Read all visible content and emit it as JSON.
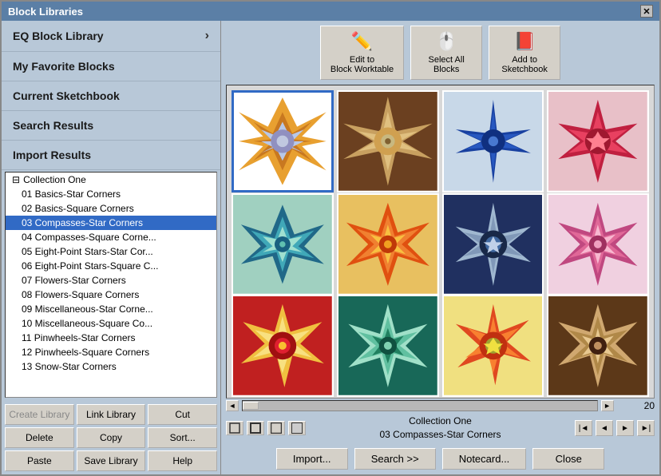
{
  "window": {
    "title": "Block Libraries",
    "close_label": "✕"
  },
  "left_nav": {
    "items": [
      {
        "id": "eq-block-library",
        "label": "EQ Block Library",
        "has_arrow": true
      },
      {
        "id": "my-favorite-blocks",
        "label": "My Favorite Blocks",
        "has_arrow": false
      },
      {
        "id": "current-sketchbook",
        "label": "Current Sketchbook",
        "has_arrow": false
      },
      {
        "id": "search-results",
        "label": "Search Results",
        "has_arrow": false
      },
      {
        "id": "import-results",
        "label": "Import Results",
        "has_arrow": false
      }
    ]
  },
  "tree": {
    "collection_label": "Collection One",
    "items": [
      "01 Basics-Star Corners",
      "02 Basics-Square Corners",
      "03 Compasses-Star Corners",
      "04 Compasses-Square Corne...",
      "05 Eight-Point Stars-Star Cor...",
      "06 Eight-Point Stars-Square C...",
      "07 Flowers-Star Corners",
      "08 Flowers-Square Corners",
      "09 Miscellaneous-Star Corne...",
      "10 Miscellaneous-Square Co...",
      "11 Pinwheels-Star Corners",
      "12 Pinwheels-Square Corners",
      "13 Snow-Star Corners"
    ],
    "selected_index": 2
  },
  "bottom_buttons": {
    "row1": [
      {
        "id": "create-library",
        "label": "Create Library",
        "disabled": true
      },
      {
        "id": "link-library",
        "label": "Link Library",
        "disabled": false
      },
      {
        "id": "cut",
        "label": "Cut",
        "disabled": false
      }
    ],
    "row2": [
      {
        "id": "delete",
        "label": "Delete",
        "disabled": false
      },
      {
        "id": "copy",
        "label": "Copy",
        "disabled": false
      },
      {
        "id": "sort",
        "label": "Sort...",
        "disabled": false
      }
    ],
    "row3": [
      {
        "id": "paste",
        "label": "Paste",
        "disabled": false
      },
      {
        "id": "save-library",
        "label": "Save Library",
        "disabled": false
      },
      {
        "id": "help",
        "label": "Help",
        "disabled": false
      }
    ]
  },
  "toolbar": {
    "edit_label": "Edit to\nBlock Worktable",
    "select_label": "Select All\nBlocks",
    "add_label": "Add to\nSketchbook"
  },
  "status": {
    "collection": "Collection One",
    "block_name": "03 Compasses-Star Corners"
  },
  "page_info": {
    "page": "20"
  },
  "action_buttons": {
    "import": "Import...",
    "search": "Search  >>",
    "notecard": "Notecard...",
    "close": "Close"
  },
  "view_sizes": [
    "S",
    "M",
    "L",
    "XL"
  ]
}
